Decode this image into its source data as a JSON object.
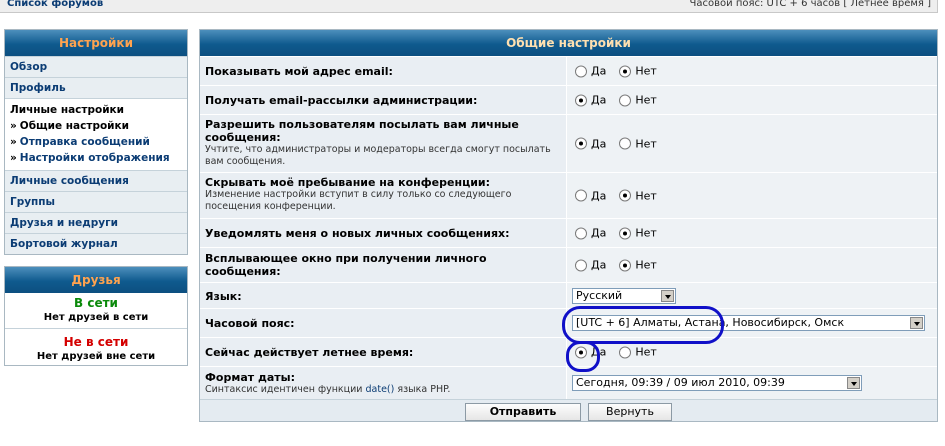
{
  "topbar": {
    "forum_list": "Список форумов",
    "timezone": "Часовой пояс: UTC + 6 часов [ Летнее время ]"
  },
  "sidebar": {
    "header": "Настройки",
    "items": [
      {
        "label": "Обзор"
      },
      {
        "label": "Профиль"
      }
    ],
    "personal": {
      "title": "Личные настройки",
      "subitems": [
        {
          "label": "Общие настройки"
        },
        {
          "label": "Отправка сообщений"
        },
        {
          "label": "Настройки отображения"
        }
      ]
    },
    "items_after": [
      {
        "label": "Личные сообщения"
      },
      {
        "label": "Группы"
      },
      {
        "label": "Друзья и недруги"
      },
      {
        "label": "Бортовой журнал"
      }
    ]
  },
  "friends": {
    "header": "Друзья",
    "online_title": "В сети",
    "online_empty": "Нет друзей в сети",
    "offline_title": "Не в сети",
    "offline_empty": "Нет друзей вне сети"
  },
  "main": {
    "header": "Общие настройки",
    "yes": "Да",
    "no": "Нет",
    "rows": [
      {
        "label": "Показывать мой адрес email:",
        "desc": "",
        "selected": "no"
      },
      {
        "label": "Получать email-рассылки администрации:",
        "desc": "",
        "selected": "yes"
      },
      {
        "label": "Разрешить пользователям посылать вам личные сообщения:",
        "desc": "Учтите, что администраторы и модераторы всегда смогут посылать вам сообщения.",
        "selected": "yes"
      },
      {
        "label": "Скрывать моё пребывание на конференции:",
        "desc": "Изменение настройки вступит в силу только со следующего посещения конференции.",
        "selected": "no"
      },
      {
        "label": "Уведомлять меня о новых личных сообщениях:",
        "desc": "",
        "selected": "no"
      },
      {
        "label": "Всплывающее окно при получении личного сообщения:",
        "desc": "",
        "selected": "no"
      }
    ],
    "language": {
      "label": "Язык:",
      "value": "Русский"
    },
    "timezone": {
      "label": "Часовой пояс:",
      "value": "[UTC + 6] Алматы, Астана, Новосибирск, Омск"
    },
    "dst": {
      "label": "Сейчас действует летнее время:",
      "selected": "yes"
    },
    "date_format": {
      "label": "Формат даты:",
      "desc_before": "Синтаксис идентичен функции",
      "desc_link": "date()",
      "desc_after": "языка PHP.",
      "value": "Сегодня, 09:39 / 09 июл 2010, 09:39"
    },
    "submit": "Отправить",
    "reset": "Вернуть"
  },
  "colors": {
    "header_gradient_top": "#4d8fbc",
    "header_gradient_bottom": "#0c4f80",
    "header_text": "#ffa34f",
    "annotation": "#1010c8"
  }
}
